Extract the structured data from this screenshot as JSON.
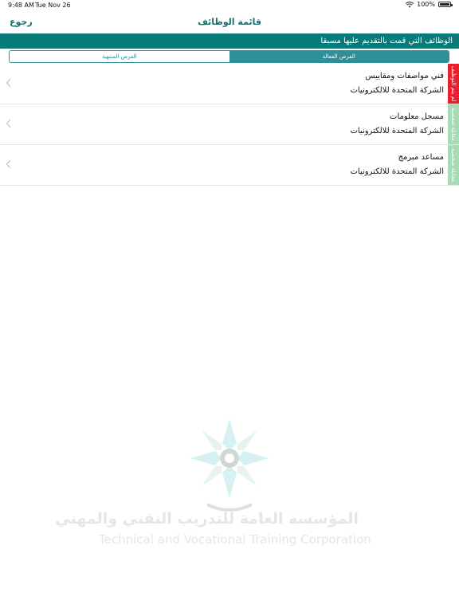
{
  "status_bar": {
    "time": "9:48 AM",
    "date": "Tue Nov 26",
    "battery": "100%"
  },
  "nav": {
    "title": "قائمة الوظائف",
    "back_label": "رجوع"
  },
  "section_header": "الوظائف التي قمت بالتقديم عليها مسبقا",
  "segments": {
    "active": "الفرص الفعالة",
    "expired": "الفرص المنتهية"
  },
  "jobs": [
    {
      "title": "فني مواصفات ومقاييس",
      "company": "الشركة المتحدة للالكترونيات",
      "status": "لم يتم التوظيف",
      "status_color": "#e8202e"
    },
    {
      "title": "مسجل معلومات",
      "company": "الشركة المتحدة للالكترونيات",
      "status": "مقابلة شخصية",
      "status_color": "#a6dbb5"
    },
    {
      "title": "مساعد مبرمج",
      "company": "الشركة المتحدة للالكترونيات",
      "status": "مقابلة شخصية",
      "status_color": "#a6dbb5"
    }
  ],
  "org_logo": {
    "name_ar": "المؤسسة العامة للتدريب التقني والمهني",
    "name_en": "Technical and Vocational Training Corporation"
  },
  "colors": {
    "primary": "#087a77",
    "accent": "#2e8f9a",
    "status_red": "#e8202e",
    "status_green": "#a6dbb5"
  }
}
